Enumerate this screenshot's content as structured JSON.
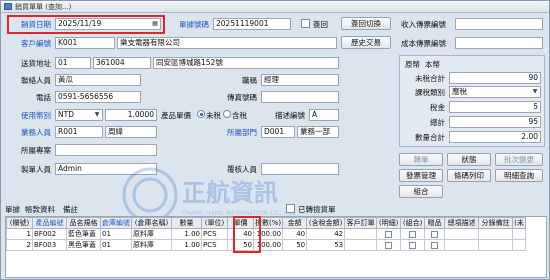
{
  "window": {
    "title": "銷貨單單 (查詢...)"
  },
  "header": {
    "sale_date_label": "銷貨日期",
    "sale_date": "2025/11/19",
    "order_no_label": "單據號碼",
    "order_no": "20251119001",
    "return_label": "簽回",
    "return_switch": "簽回切換",
    "customer_label": "客戶編號",
    "customer_code": "K001",
    "customer_name": "樂支電器有限公司",
    "history_button": "歷史交易",
    "ship_addr_label": "送貨地址",
    "ship_addr_code": "01",
    "ship_zip": "361004",
    "ship_addr": "同安區博城路152號",
    "contact_label": "聯絡人員",
    "contact": "黃瓜",
    "title_label": "職稱",
    "title": "經理",
    "phone_label": "電話",
    "phone": "0591-5656556",
    "fax_label": "傳真號碼",
    "fax": "",
    "currency_label": "使用幣別",
    "currency": "NTD",
    "rate": "1.0000",
    "price_label": "產品單價",
    "tax_excl": "未稅",
    "tax_incl": "含稅",
    "desc_code_label": "描述編號",
    "desc_code": "A",
    "sales_label": "業務人員",
    "sales_code": "R001",
    "sales_name": "周緯",
    "dept_label": "所屬部門",
    "dept_code": "D001",
    "dept_name": "業務一部",
    "project_label": "所屬專案",
    "project": "",
    "maker_label": "製單人員",
    "maker": "Admin",
    "reviewer_label": "覆核人員",
    "reviewer": ""
  },
  "right_panel": {
    "receipt_no_label": "收入傳票編號",
    "receipt_no": "",
    "cost_no_label": "成本傳票編號",
    "cost_no": "",
    "tabs": [
      "原幣",
      "本幣"
    ],
    "pretax_label": "未稅合計",
    "pretax": "90",
    "tax_type_label": "課稅類別",
    "tax_type": "應稅",
    "tax_label": "稅金",
    "tax": "5",
    "total_label": "總計",
    "total": "95",
    "qty_total_label": "數量合計",
    "qty_total": "2.00"
  },
  "actions": {
    "transfer": "轉單",
    "status": "狀態",
    "batch_change": "批次變更",
    "invoice_mgmt": "發票管理",
    "barcode_print": "條碼列印",
    "detail_query": "明細查詢",
    "combine": "組合"
  },
  "tabs": [
    "單據",
    "帳款資料",
    "備註"
  ],
  "converted_label": "已轉撿貨單",
  "grid": {
    "headers": [
      "(欄號)",
      "產品編號",
      "品名規格",
      "倉庫編號",
      "(倉庫名稱)",
      "數量",
      "(單位)",
      "單價",
      "折數(%)",
      "金額",
      "(含稅金額)",
      "客戶訂單",
      "(明細)",
      "(組合)",
      "贈品",
      "總項描述",
      "分錄備註",
      "(未"
    ],
    "rows": [
      {
        "no": "1",
        "code": "BF002",
        "name": "藍色筆蓋",
        "wh": "01",
        "wh_name": "原料庫",
        "qty": "1.00",
        "unit": "PCS",
        "price": "40",
        "disc": "100.00",
        "amt": "40",
        "amt_tax": "42",
        "cust_order": ""
      },
      {
        "no": "2",
        "code": "BF003",
        "name": "黑色筆蓋",
        "wh": "01",
        "wh_name": "原料庫",
        "qty": "1.00",
        "unit": "PCS",
        "price": "50",
        "disc": "100.00",
        "amt": "50",
        "amt_tax": "53",
        "cust_order": ""
      }
    ]
  },
  "watermark": {
    "text": "正航資訊",
    "sub": "CHANG HANG INFORMATION CO., LTD."
  },
  "colors": {
    "accent": "#1b57c6",
    "highlight": "#e0262a"
  }
}
